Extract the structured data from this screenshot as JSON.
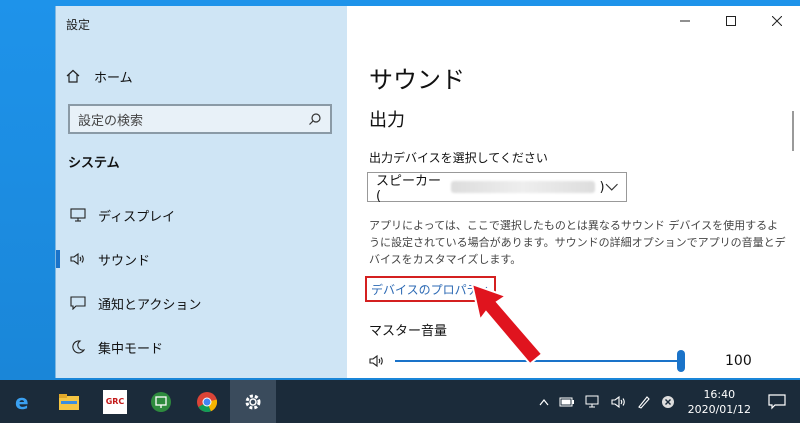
{
  "window": {
    "title": "設定"
  },
  "sidebar": {
    "home": "ホーム",
    "search_placeholder": "設定の検索",
    "section": "システム",
    "items": [
      {
        "label": "ディスプレイ",
        "icon": "monitor-icon"
      },
      {
        "label": "サウンド",
        "icon": "speaker-icon",
        "active": true
      },
      {
        "label": "通知とアクション",
        "icon": "message-icon"
      },
      {
        "label": "集中モード",
        "icon": "moon-icon"
      }
    ]
  },
  "main": {
    "page_title": "サウンド",
    "section_title": "出力",
    "output_label": "出力デバイスを選択してください",
    "device_prefix": "スピーカー (",
    "device_suffix": ")",
    "description": "アプリによっては、ここで選択したものとは異なるサウンド デバイスを使用するように設定されている場合があります。サウンドの詳細オプションでアプリの音量とデバイスをカスタマイズします。",
    "device_properties_link": "デバイスのプロパティ",
    "master_volume_label": "マスター音量",
    "volume_value": "100",
    "volume_level": 1.0
  },
  "taskbar": {
    "apps": [
      "edge-icon",
      "file-explorer-icon",
      "ggc-app-icon",
      "presentation-app-icon",
      "chrome-icon",
      "settings-icon"
    ],
    "ggc_text": "GRC",
    "time": "16:40",
    "date": "2020/01/12"
  },
  "colors": {
    "accent": "#1a73c9",
    "highlight_box": "#d42020",
    "arrow": "#e0141e",
    "link": "#2d6ab4"
  }
}
